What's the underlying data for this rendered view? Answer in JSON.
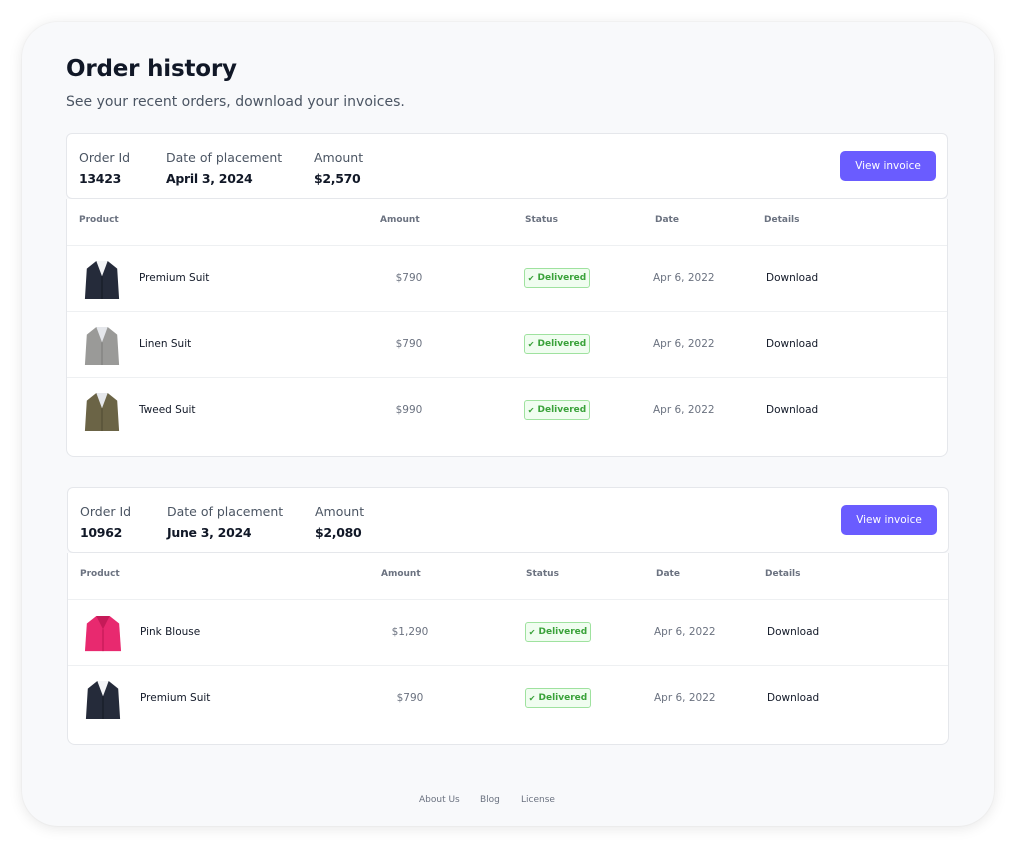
{
  "page": {
    "title": "Order history",
    "subtitle": "See your recent orders, download your invoices."
  },
  "labels": {
    "order_id": "Order Id",
    "date_of_placement": "Date of placement",
    "amount": "Amount",
    "view_invoice": "View invoice"
  },
  "table_headers": {
    "product": "Product",
    "amount": "Amount",
    "status": "Status",
    "date": "Date",
    "details": "Details"
  },
  "orders": [
    {
      "id": "13423",
      "date": "April 3, 2024",
      "amount": "$2,570",
      "items": [
        {
          "name": "Premium Suit",
          "amount": "$790",
          "status": "Delivered",
          "date": "Apr 6, 2022",
          "action": "Download",
          "image": "navy-suit-jacket",
          "color": "#252b3a"
        },
        {
          "name": "Linen Suit",
          "amount": "$790",
          "status": "Delivered",
          "date": "Apr 6, 2022",
          "action": "Download",
          "image": "grey-suit-jacket",
          "color": "#9a9a98"
        },
        {
          "name": "Tweed Suit",
          "amount": "$990",
          "status": "Delivered",
          "date": "Apr 6, 2022",
          "action": "Download",
          "image": "olive-suit-jacket",
          "color": "#6b6446"
        }
      ]
    },
    {
      "id": "10962",
      "date": "June 3, 2024",
      "amount": "$2,080",
      "items": [
        {
          "name": "Pink Blouse",
          "amount": "$1,290",
          "status": "Delivered",
          "date": "Apr 6, 2022",
          "action": "Download",
          "image": "pink-blazer",
          "color": "#e8296f"
        },
        {
          "name": "Premium Suit",
          "amount": "$790",
          "status": "Delivered",
          "date": "Apr 6, 2022",
          "action": "Download",
          "image": "navy-suit-jacket",
          "color": "#252b3a"
        }
      ]
    }
  ],
  "footer": {
    "links": [
      "About Us",
      "Blog",
      "License"
    ]
  },
  "colors": {
    "accent": "#6a5cff",
    "status_success": "#3aa23a",
    "status_success_bg": "#f0fdf0"
  }
}
